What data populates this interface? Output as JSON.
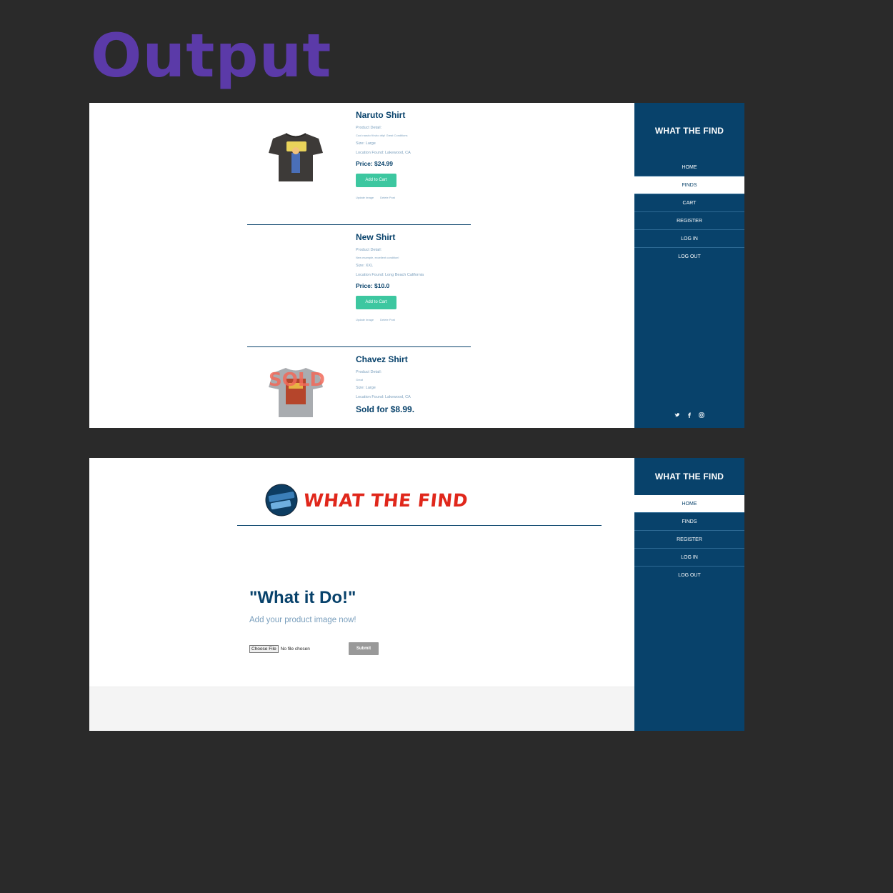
{
  "heading": "Output",
  "colors": {
    "heading": "#5b3aa8",
    "sidebar": "#08426b",
    "cart_button": "#3dc7a0",
    "logo_red": "#e0271b",
    "background": "#2a2a2a"
  },
  "shot1": {
    "brand": "WHAT THE FIND",
    "nav": [
      "HOME",
      "FINDS",
      "CART",
      "REGISTER",
      "LOG IN",
      "LOG OUT"
    ],
    "active_nav": "FINDS",
    "socials": [
      "twitter-icon",
      "facebook-icon",
      "instagram-icon"
    ],
    "products": [
      {
        "name": "Naruto Shirt",
        "detail_label": "Product Detail:",
        "description": "Cool naruto fit sho drip! Great Conditions",
        "size": "Size: Large",
        "location": "Location Found: Lakewood, CA",
        "price": "Price: $24.99",
        "cart_label": "Add to Cart",
        "update_label": "Update Image",
        "delete_label": "Delete Post"
      },
      {
        "name": "New Shirt",
        "detail_label": "Product Detail:",
        "description": "New example, excellent condition!",
        "size": "Size: XXL",
        "location": "Location Found: Long Beach California",
        "price": "Price: $10.0",
        "cart_label": "Add to Cart",
        "update_label": "Update Image",
        "delete_label": "Delete Post"
      },
      {
        "name": "Chavez Shirt",
        "detail_label": "Product Detail:",
        "description": "Great",
        "size": "Size: Large",
        "location": "Location Found: Lakewood, CA",
        "sold": "Sold for $8.99."
      }
    ]
  },
  "shot2": {
    "brand": "WHAT THE FIND",
    "nav": [
      "HOME",
      "FINDS",
      "REGISTER",
      "LOG IN",
      "LOG OUT"
    ],
    "active_nav": "HOME",
    "logo_text": "WHAT THE FIND",
    "quote": "\"What it Do!\"",
    "subtitle": "Add your product image now!",
    "choose_file": "Choose File",
    "no_file": "No file chosen",
    "submit": "Submit"
  }
}
